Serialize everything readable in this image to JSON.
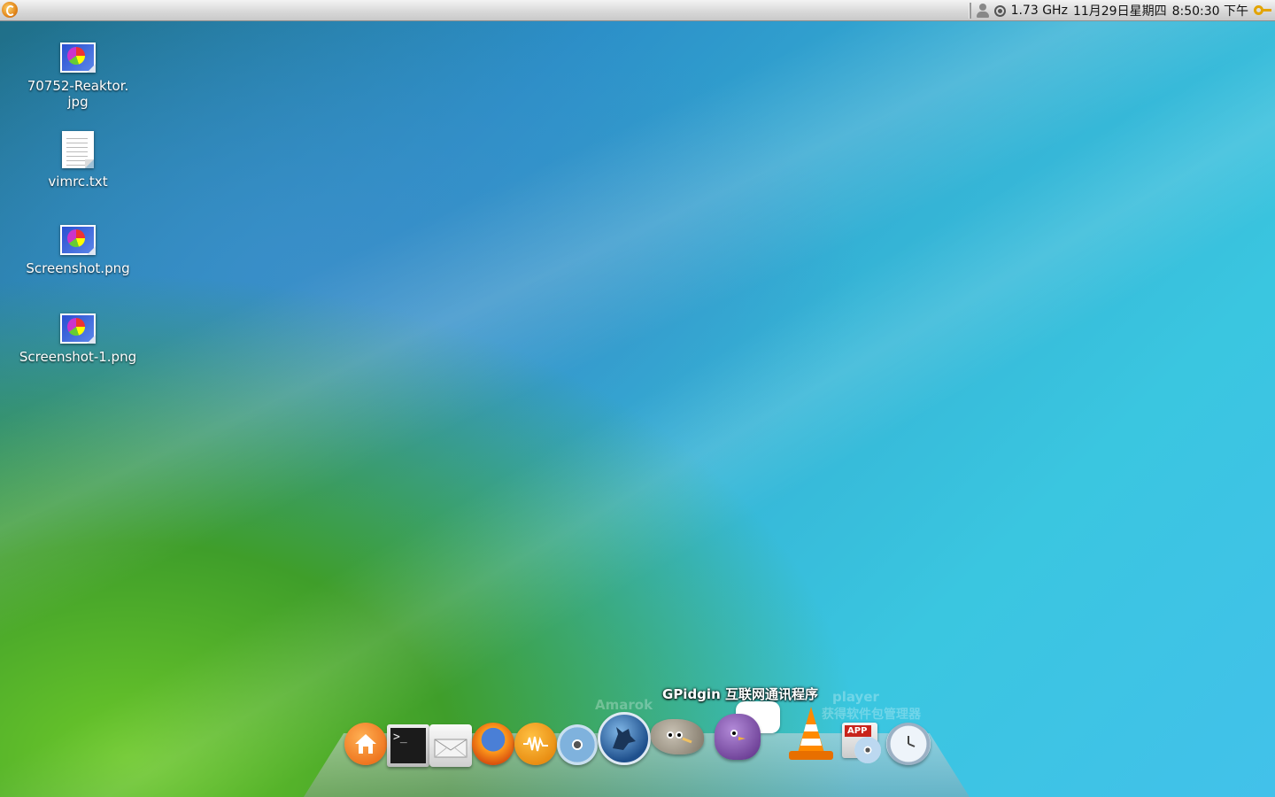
{
  "panel": {
    "cpu_freq": "1.73 GHz",
    "date": "11月29日星期四",
    "time": "8:50:30 下午"
  },
  "desktop_icons": [
    {
      "label": "70752-Reaktor.\njpg",
      "type": "image"
    },
    {
      "label": "vimrc.txt",
      "type": "text"
    },
    {
      "label": "Screenshot.png",
      "type": "image"
    },
    {
      "label": "Screenshot-1.png",
      "type": "image"
    }
  ],
  "dock": {
    "active_label": "Pidgin 互联网通讯程序",
    "active_prefix": "G",
    "faint_labels": [
      "Amarok",
      "player",
      "获得软件包管理器"
    ],
    "items": [
      {
        "name": "home",
        "icon": "home-icon"
      },
      {
        "name": "terminal",
        "icon": "terminal-icon"
      },
      {
        "name": "mail",
        "icon": "mail-icon"
      },
      {
        "name": "firefox",
        "icon": "firefox-icon"
      },
      {
        "name": "audio",
        "icon": "audio-wave-icon"
      },
      {
        "name": "media",
        "icon": "disc-icon"
      },
      {
        "name": "amarok",
        "icon": "wolf-icon"
      },
      {
        "name": "gimp",
        "icon": "gimp-icon"
      },
      {
        "name": "pidgin",
        "icon": "pidgin-icon"
      },
      {
        "name": "vlc",
        "icon": "vlc-cone-icon"
      },
      {
        "name": "app-installer",
        "icon": "app-disc-icon"
      },
      {
        "name": "clock",
        "icon": "clock-icon"
      }
    ]
  }
}
